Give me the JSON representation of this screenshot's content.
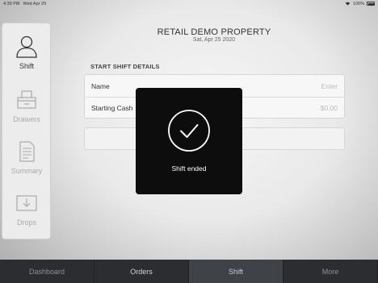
{
  "status_bar": {
    "time": "4:39 PM",
    "date": "Wed Apr 29",
    "battery": "100%"
  },
  "sidebar": {
    "items": [
      {
        "label": "Shift",
        "icon": "person-icon",
        "active": true
      },
      {
        "label": "Drawers",
        "icon": "cash-drawer-icon",
        "active": false
      },
      {
        "label": "Summary",
        "icon": "document-icon",
        "active": false
      },
      {
        "label": "Drops",
        "icon": "drop-box-icon",
        "active": false
      }
    ]
  },
  "header": {
    "title": "RETAIL DEMO PROPERTY",
    "date": "Sat, Apr 25 2020"
  },
  "form": {
    "section_title": "START SHIFT DETAILS",
    "rows": [
      {
        "label": "Name",
        "placeholder": "Enter"
      },
      {
        "label": "Starting Cash",
        "value": "$0.00"
      }
    ]
  },
  "toast": {
    "message": "Shift ended",
    "icon": "checkmark-circle-icon"
  },
  "tabbar": {
    "tabs": [
      {
        "label": "Dashboard",
        "selected": false
      },
      {
        "label": "Orders",
        "selected": false
      },
      {
        "label": "Shift",
        "selected": true
      },
      {
        "label": "More",
        "selected": false
      }
    ]
  },
  "colors": {
    "toast_bg": "#0d0d0d",
    "tabbar_bg": "#2b2d31",
    "tab_selected_bg": "#3f4247"
  }
}
